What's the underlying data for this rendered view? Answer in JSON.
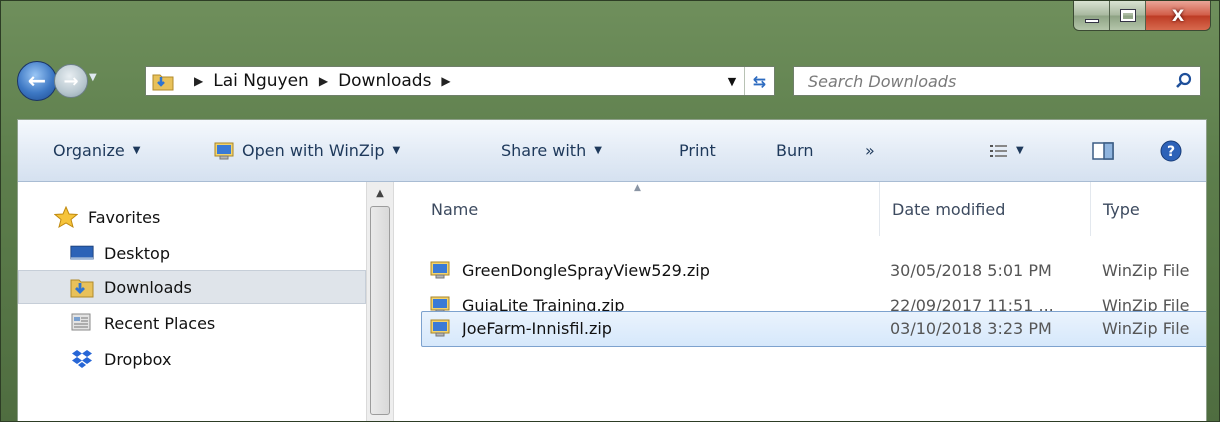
{
  "window": {
    "caption_buttons": {
      "minimize_icon": "minimize-icon",
      "maximize_icon": "maximize-icon",
      "close_label": "X"
    }
  },
  "nav": {
    "breadcrumbs": [
      "Lai Nguyen",
      "Downloads"
    ],
    "search_placeholder": "Search Downloads"
  },
  "toolbar": {
    "organize": "Organize",
    "open_with": "Open with WinZip",
    "share_with": "Share with",
    "print": "Print",
    "burn": "Burn",
    "more": "»"
  },
  "sidebar": {
    "items": [
      {
        "label": "Favorites",
        "icon": "star-icon"
      },
      {
        "label": "Desktop",
        "icon": "desktop-icon"
      },
      {
        "label": "Downloads",
        "icon": "downloads-folder-icon",
        "selected": true
      },
      {
        "label": "Recent Places",
        "icon": "recent-places-icon"
      },
      {
        "label": "Dropbox",
        "icon": "dropbox-icon"
      }
    ]
  },
  "files": {
    "columns": [
      "Name",
      "Date modified",
      "Type"
    ],
    "rows": [
      {
        "name": "GreenDongleSprayView529.zip",
        "date": "30/05/2018 5:01 PM",
        "type": "WinZip File"
      },
      {
        "name": "GuiaLite Training.zip",
        "date": "22/09/2017 11:51 ...",
        "type": "WinZip File"
      },
      {
        "name": "JoeFarm-Innisfil.zip",
        "date": "03/10/2018 3:23 PM",
        "type": "WinZip File",
        "selected": true
      }
    ]
  },
  "colors": {
    "accent": "#3d78c4",
    "selection": "#d6e8fb",
    "toolbar_text": "#1e395b"
  }
}
